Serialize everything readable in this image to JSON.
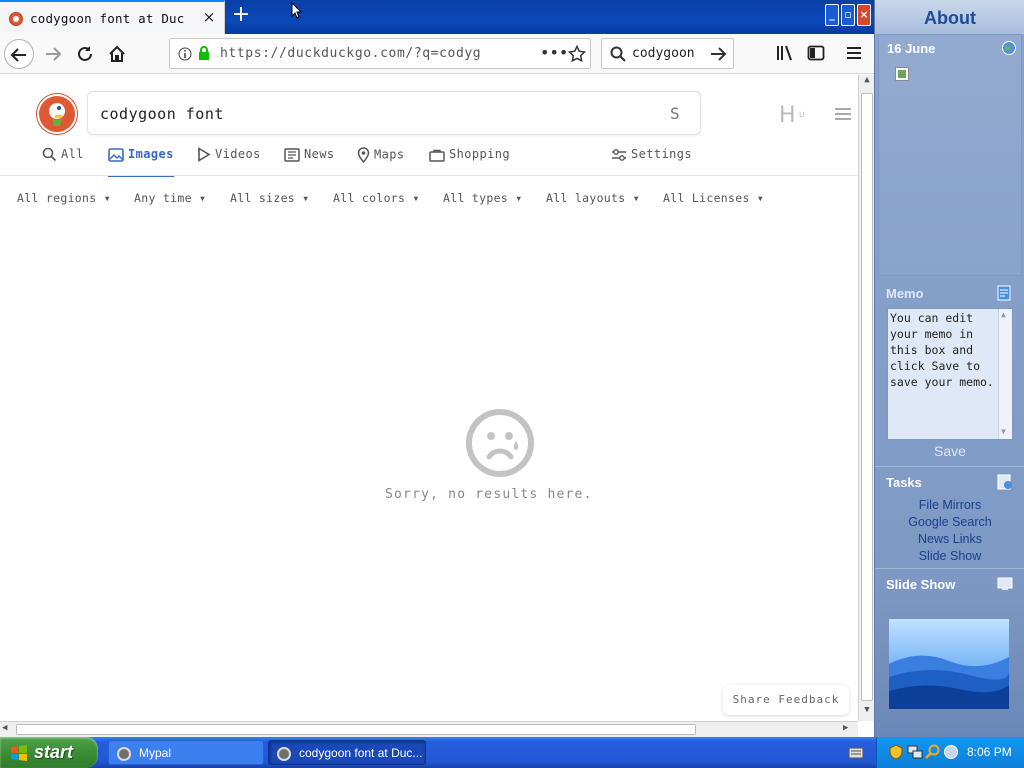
{
  "browser": {
    "tab_title": "codygoon font at Duc",
    "url": "https://duckduckgo.com/?q=codyg",
    "search_value": "codygoon",
    "new_tab_label": "+",
    "close_tab_label": "×"
  },
  "page": {
    "query": "codygoon font",
    "search_right_glyph": "S",
    "avatar_letter": "H",
    "nav": [
      {
        "label": "All",
        "icon": "search-icon"
      },
      {
        "label": "Images",
        "icon": "image-icon",
        "active": true
      },
      {
        "label": "Videos",
        "icon": "play-icon"
      },
      {
        "label": "News",
        "icon": "news-icon"
      },
      {
        "label": "Maps",
        "icon": "map-pin-icon"
      },
      {
        "label": "Shopping",
        "icon": "shopping-bag-icon"
      }
    ],
    "settings_label": "Settings",
    "filters": [
      "All regions",
      "Any time",
      "All sizes",
      "All colors",
      "All types",
      "All layouts",
      "All Licenses"
    ],
    "no_results": "Sorry, no results here.",
    "share_feedback": "Share Feedback",
    "accent_color": "#3969c6"
  },
  "side_panel": {
    "title": "About",
    "date": "16 June",
    "memo_title": "Memo",
    "memo_text": "You can edit your memo in this box and click Save to save your memo.",
    "save_label": "Save",
    "tasks_title": "Tasks",
    "tasks": [
      "File Mirrors",
      "Google Search",
      "News Links",
      "Slide Show"
    ],
    "slideshow_title": "Slide Show"
  },
  "taskbar": {
    "start_label": "start",
    "items": [
      "Mypal",
      "codygoon font at Duc..."
    ],
    "clock": "8:06 PM"
  }
}
